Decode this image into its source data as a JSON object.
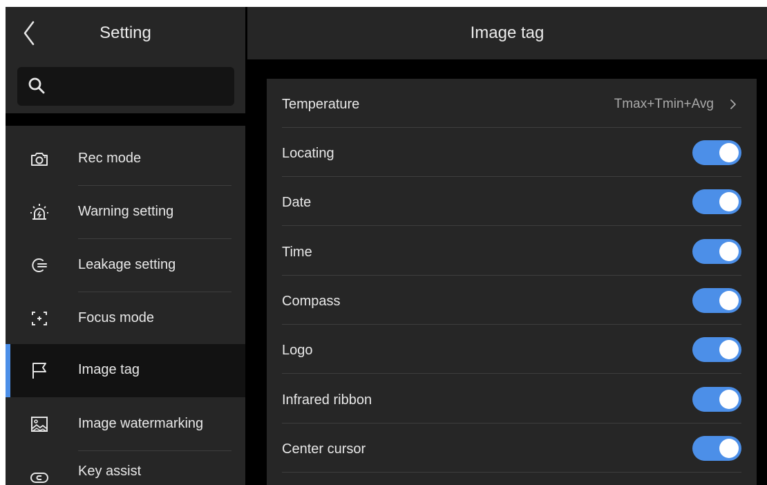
{
  "left": {
    "title": "Setting",
    "search": {
      "placeholder": "",
      "value": ""
    },
    "menu": [
      {
        "label": "Rec mode",
        "icon": "camera-icon",
        "active": false
      },
      {
        "label": "Warning setting",
        "icon": "alarm-light-icon",
        "active": false
      },
      {
        "label": "Leakage setting",
        "icon": "gas-leak-icon",
        "active": false
      },
      {
        "label": "Focus mode",
        "icon": "focus-frame-icon",
        "active": false
      },
      {
        "label": "Image tag",
        "icon": "flag-icon",
        "active": true
      },
      {
        "label": "Image watermarking",
        "icon": "image-watermark-icon",
        "active": false
      },
      {
        "label": "Key assist",
        "icon": "key-assist-icon",
        "active": false
      }
    ]
  },
  "right": {
    "title": "Image tag",
    "rows": [
      {
        "label": "Temperature",
        "value": "Tmax+Tmin+Avg",
        "type": "link"
      },
      {
        "label": "Locating",
        "type": "toggle",
        "on": true
      },
      {
        "label": "Date",
        "type": "toggle",
        "on": true
      },
      {
        "label": "Time",
        "type": "toggle",
        "on": true
      },
      {
        "label": "Compass",
        "type": "toggle",
        "on": true
      },
      {
        "label": "Logo",
        "type": "toggle",
        "on": true
      },
      {
        "label": "Infrared ribbon",
        "type": "toggle",
        "on": true
      },
      {
        "label": "Center cursor",
        "type": "toggle",
        "on": true
      }
    ]
  },
  "colors": {
    "accent": "#4c8fe8",
    "panel": "#262626",
    "background": "#000000"
  }
}
